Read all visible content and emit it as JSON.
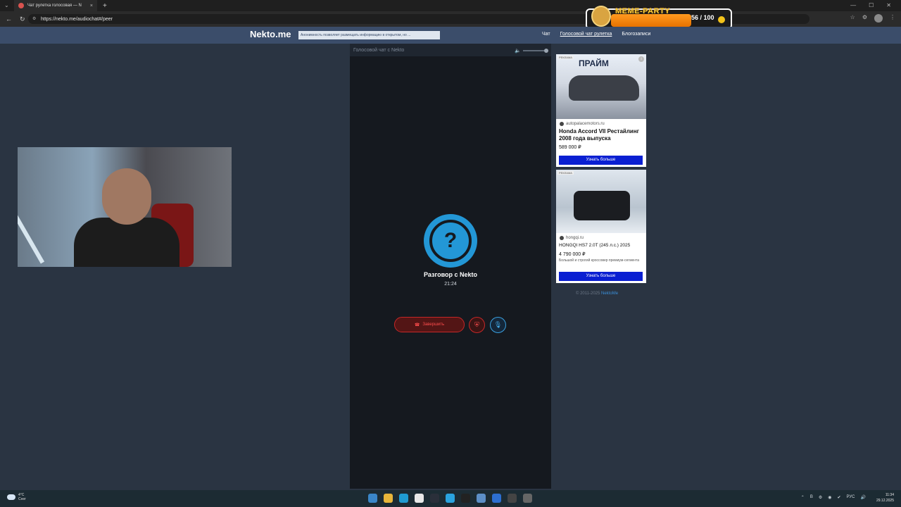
{
  "browser": {
    "tab_title": "Чат рулетка голосовая — N",
    "url": "https://nekto.me/audiochat#/peer",
    "new_tab": "+",
    "close_tab": "×"
  },
  "overlay": {
    "title": "MEME-PARTY",
    "counter": "56 / 100"
  },
  "site": {
    "logo": "Nekto.me",
    "notice": "Анонимность позволяет размещать информацию в открытом, но ...",
    "nav": [
      "Чат",
      "Голосовой чат рулетка",
      "Блогозаписи"
    ]
  },
  "voice": {
    "header": "Голосовой чат с Nekto",
    "question_mark": "?",
    "title": "Разговор с Nekto",
    "timer": "21:24",
    "end_label": "Завершить"
  },
  "ads": [
    {
      "tag": "РЕКЛАМА",
      "brand": "ПРАЙМ",
      "domain": "autopalacemotors.ru",
      "headline": "Honda Accord VII Рестайлинг 2008 года выпуска",
      "price": "589 000 ₽",
      "cta": "Узнать больше"
    },
    {
      "tag": "РЕКЛАМА",
      "domain": "hongqi.ru",
      "headline": "HONGQI HS7 2.0T (245 л.с.) 2025",
      "price": "4 790 000 ₽",
      "desc": "Большой и строгий кроссовер премиум-сегмента",
      "cta": "Узнать больше"
    }
  ],
  "footer": {
    "copyright": "© 2011-2025",
    "link": "NektoMe"
  },
  "taskbar": {
    "temp": "4°C",
    "weather": "Снег",
    "lang": "РУС",
    "time": "11:34",
    "date": "29.12.2025"
  },
  "colors": {
    "accent": "#2397d6",
    "danger": "#c62828",
    "header": "#3b4d6a",
    "background": "#2a3442"
  }
}
